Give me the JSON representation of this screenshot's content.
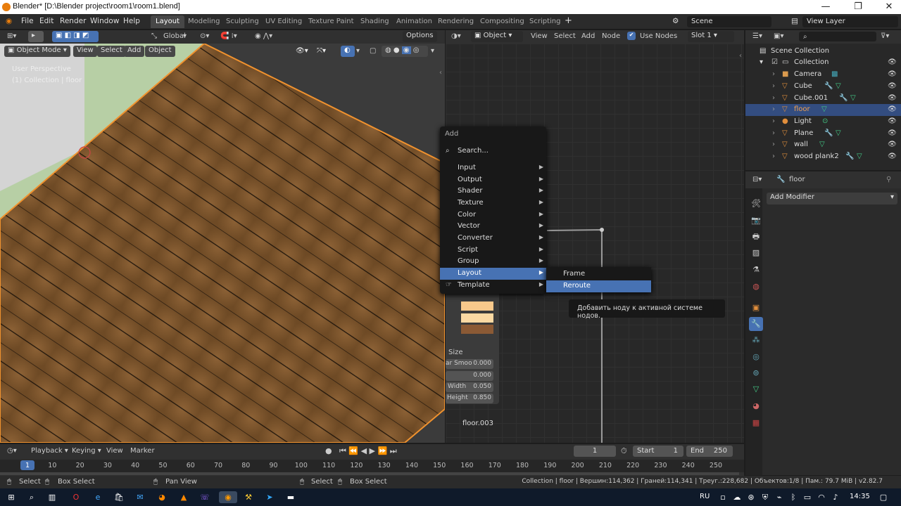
{
  "window": {
    "title": "Blender* [D:\\Blender project\\room1\\room1.blend]",
    "minimize": "—",
    "maximize": "❐",
    "close": "✕"
  },
  "menu": [
    "File",
    "Edit",
    "Render",
    "Window",
    "Help"
  ],
  "workspaces": [
    "Layout",
    "Modeling",
    "Sculpting",
    "UV Editing",
    "Texture Paint",
    "Shading",
    "Animation",
    "Rendering",
    "Compositing",
    "Scripting"
  ],
  "scene": {
    "name": "Scene",
    "view_layer": "View Layer"
  },
  "viewport": {
    "orientation": "Global",
    "options": "Options",
    "mode": "Object Mode",
    "menus": [
      "View",
      "Select",
      "Add",
      "Object"
    ],
    "overlay_line1": "User Perspective",
    "overlay_line2": "(1) Collection | floor"
  },
  "node_editor": {
    "type": "Object",
    "menus": [
      "View",
      "Select",
      "Add",
      "Node"
    ],
    "use_nodes": "Use Nodes",
    "slot": "Slot 1",
    "node_label": "floor.003",
    "node_fields": [
      {
        "label": "Size",
        "value": ""
      },
      {
        "label": "ar Smoo",
        "value": "0.000"
      },
      {
        "label": "",
        "value": "0.000"
      },
      {
        "label": "Width",
        "value": "0.050"
      },
      {
        "label": "Height",
        "value": "0.850"
      }
    ],
    "swatch_colors": [
      "#f9c98b",
      "#fbd9a3",
      "#8b5a35"
    ]
  },
  "add_menu": {
    "title": "Add",
    "search": "Search...",
    "items": [
      "Input",
      "Output",
      "Shader",
      "Texture",
      "Color",
      "Vector",
      "Converter",
      "Script",
      "Group",
      "Layout",
      "Template"
    ],
    "highlighted": "Layout",
    "submenu": [
      "Frame",
      "Reroute"
    ],
    "tooltip": "Добавить ноду к активной системе нодов."
  },
  "outliner": {
    "root": "Scene Collection",
    "collection": "Collection",
    "items": [
      "Camera",
      "Cube",
      "Cube.001",
      "floor",
      "Light",
      "Plane",
      "wall",
      "wood plank2"
    ],
    "selected": "floor"
  },
  "properties": {
    "object": "floor",
    "add_modifier": "Add Modifier"
  },
  "timeline": {
    "menus": [
      "Playback",
      "Keying",
      "View",
      "Marker"
    ],
    "current_frame": "1",
    "start_label": "Start",
    "start": "1",
    "end_label": "End",
    "end": "250",
    "ticks": [
      "1",
      "10",
      "20",
      "30",
      "40",
      "50",
      "60",
      "70",
      "80",
      "90",
      "100",
      "110",
      "120",
      "130",
      "140",
      "150",
      "160",
      "170",
      "180",
      "190",
      "200",
      "210",
      "220",
      "230",
      "240",
      "250"
    ]
  },
  "statusbar": {
    "left_select": "Select",
    "left_box": "Box Select",
    "pan": "Pan View",
    "mid_select": "Select",
    "mid_box": "Box Select",
    "stats": "Collection | floor | Вершин:114,362 | Граней:114,341 | Треуг.:228,682 | Объектов:1/8 | Пам.: 79.7 MiB | v2.82.7"
  },
  "taskbar": {
    "lang": "RU",
    "time": "14:35"
  },
  "colors": {
    "accent": "#4772b3",
    "selected_row": "#334d80",
    "orange": "#e87d0d"
  }
}
